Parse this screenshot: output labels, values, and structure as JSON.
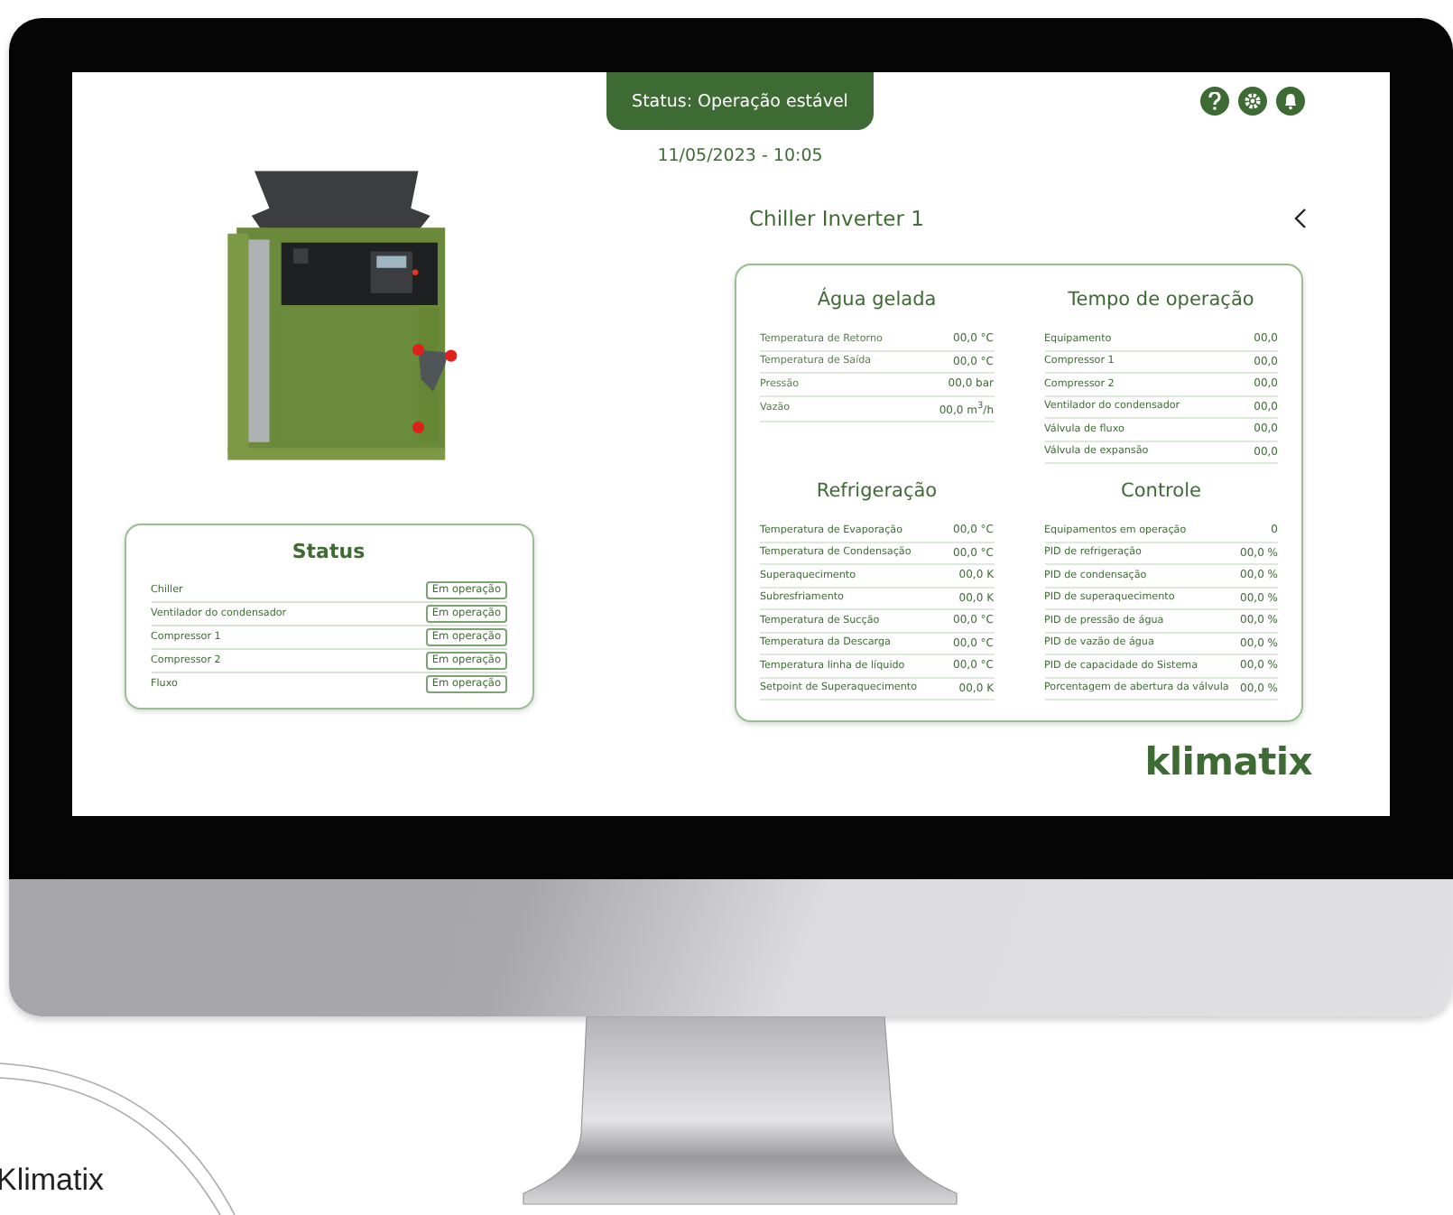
{
  "status_banner": "Status: Operação estável",
  "datetime": "11/05/2023 - 10:05",
  "device_title": "Chiller Inverter 1",
  "status_panel": {
    "title": "Status",
    "rows": [
      {
        "label": "Chiller",
        "status": "Em operação"
      },
      {
        "label": "Ventilador do condensador",
        "status": "Em operação"
      },
      {
        "label": "Compressor 1",
        "status": "Em operação"
      },
      {
        "label": "Compressor 2",
        "status": "Em operação"
      },
      {
        "label": "Fluxo",
        "status": "Em operação"
      }
    ]
  },
  "sections": [
    {
      "title": "Água gelada",
      "rows": [
        {
          "label": "Temperatura de Retorno",
          "value": "00,0 °C"
        },
        {
          "label": "Temperatura de Saída",
          "value": "00,0 °C"
        },
        {
          "label": "Pressão",
          "value": "00,0 bar"
        },
        {
          "label": "Vazão",
          "value": "00,0 m$^{3}$/h"
        }
      ]
    },
    {
      "title": "Tempo de operação",
      "rows": [
        {
          "label": "Equipamento",
          "value": "00,0"
        },
        {
          "label": "Compressor 1",
          "value": "00,0"
        },
        {
          "label": "Compressor 2",
          "value": "00,0"
        },
        {
          "label": "Ventilador do condensador",
          "value": "00,0"
        },
        {
          "label": "Válvula de fluxo",
          "value": "00,0"
        },
        {
          "label": "Válvula de expansão",
          "value": "00,0"
        }
      ]
    },
    {
      "title": "Refrigeração",
      "rows": [
        {
          "label": "Temperatura de Evaporação",
          "value": "00,0 °C"
        },
        {
          "label": "Temperatura de Condensação",
          "value": "00,0 °C"
        },
        {
          "label": "Superaquecimento",
          "value": "00,0 K"
        },
        {
          "label": "Subresfriamento",
          "value": "00,0 K"
        },
        {
          "label": "Temperatura de Sucção",
          "value": "00,0 °C"
        },
        {
          "label": "Temperatura da Descarga",
          "value": "00,0 °C"
        },
        {
          "label": "Temperatura linha de líquido",
          "value": "00,0 °C"
        },
        {
          "label": "Setpoint de Superaquecimento",
          "value": "00,0 K"
        }
      ]
    },
    {
      "title": "Controle",
      "rows": [
        {
          "label": "Equipamentos em operação",
          "value": "0"
        },
        {
          "label": "PID de refrigeração",
          "value": "00,0 %"
        },
        {
          "label": "PID de condensação",
          "value": "00,0 %"
        },
        {
          "label": "PID de superaquecimento",
          "value": "00,0 %"
        },
        {
          "label": "PID de pressão de água",
          "value": "00,0 %"
        },
        {
          "label": "PID de vazão de água",
          "value": "00,0 %"
        },
        {
          "label": "PID de capacidade do Sistema",
          "value": "00,0 %"
        },
        {
          "label": "Porcentagem de abertura da válvula",
          "value": "00,0 %"
        }
      ]
    }
  ],
  "logo": "klimatix",
  "caption": "Klimatix"
}
